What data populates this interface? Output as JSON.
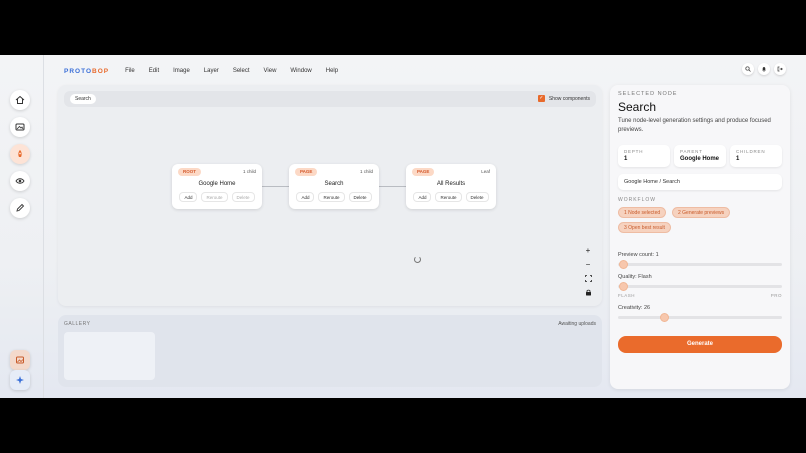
{
  "menubar": {
    "logo_a": "PROTO",
    "logo_b": "BOP",
    "items": [
      "File",
      "Edit",
      "Image",
      "Layer",
      "Select",
      "View",
      "Window",
      "Help"
    ],
    "icons": [
      "search-icon",
      "bell-icon",
      "logout-icon"
    ]
  },
  "rail": {
    "items": [
      "home-icon",
      "image-icon",
      "rocket-icon",
      "eye-icon",
      "pencil-icon"
    ],
    "active": "rocket-icon",
    "bottom": [
      "gallery-icon",
      "sparkle-icon"
    ]
  },
  "canvas": {
    "search_label": "Search",
    "show_components_label": "Show components",
    "show_components_checked": true,
    "nodes": [
      {
        "badge": "ROOT",
        "meta": "1 child",
        "title": "Google Home",
        "actions": [
          "Add",
          "Reroute",
          "Delete"
        ],
        "disabled": [
          "Reroute",
          "Delete"
        ]
      },
      {
        "badge": "PAGE",
        "meta": "1 child",
        "title": "Search",
        "actions": [
          "Add",
          "Reroute",
          "Delete"
        ],
        "disabled": []
      },
      {
        "badge": "PAGE",
        "meta": "Leaf",
        "title": "All Results",
        "actions": [
          "Add",
          "Reroute",
          "Delete"
        ],
        "disabled": []
      }
    ],
    "zoom_controls": [
      "+",
      "−",
      "fit-icon",
      "lock-icon"
    ]
  },
  "gallery": {
    "title": "GALLERY",
    "status": "Awaiting uploads"
  },
  "panel": {
    "label": "SELECTED NODE",
    "title": "Search",
    "description": "Tune node-level generation settings and produce focused previews.",
    "stats": [
      {
        "key": "DEPTH",
        "value": "1"
      },
      {
        "key": "PARENT",
        "value": "Google Home"
      },
      {
        "key": "CHILDREN",
        "value": "1"
      }
    ],
    "path": "Google Home / Search",
    "workflow_label": "WORKFLOW",
    "workflow_steps": [
      "1 Node selected",
      "2 Generate previews",
      "3 Open best result"
    ],
    "preview_count_label": "Preview count: 1",
    "preview_count_value": 1,
    "quality_label": "Quality: Flash",
    "quality_min": "FLASH",
    "quality_max": "PRO",
    "creativity_label": "Creativity: 26",
    "creativity_value": 26,
    "generate_label": "Generate",
    "accent": "#ea6b2c"
  }
}
